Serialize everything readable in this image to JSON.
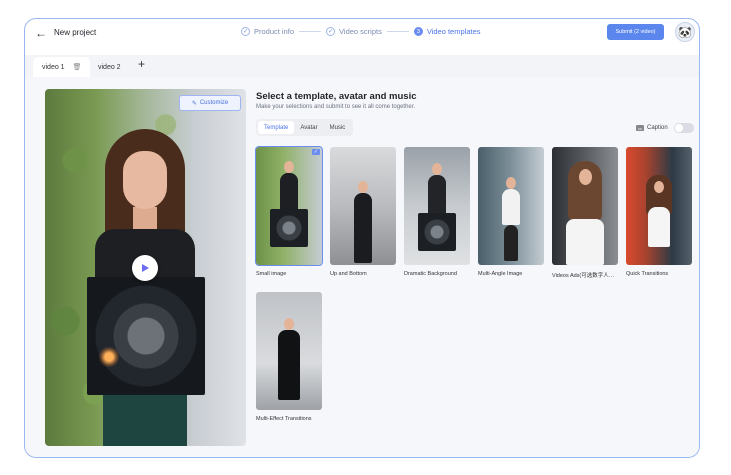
{
  "header": {
    "project_title": "New project",
    "steps": [
      {
        "label": "Product info",
        "state": "done"
      },
      {
        "label": "Video scripts",
        "state": "done"
      },
      {
        "label": "Video templates",
        "state": "active",
        "number": "3"
      }
    ],
    "submit_label": "Submit (2 video)"
  },
  "tabs": [
    {
      "label": "video 1",
      "active": true
    },
    {
      "label": "video 2",
      "active": false
    }
  ],
  "preview": {
    "customize_label": "Customize"
  },
  "panel": {
    "title": "Select a template, avatar and music",
    "subtitle": "Make your selections and submit to see it all come together.",
    "segments": [
      "Template",
      "Avatar",
      "Music"
    ],
    "active_segment": "Template",
    "caption_label": "Caption",
    "caption_on": false
  },
  "templates": [
    {
      "label": "Small image",
      "selected": true
    },
    {
      "label": "Up and Bottom",
      "selected": false
    },
    {
      "label": "Dramatic Background",
      "selected": false
    },
    {
      "label": "Multi-Angle Image",
      "selected": false
    },
    {
      "label": "Videos Ads(可选数字人…",
      "selected": false
    },
    {
      "label": "Quick Transitions",
      "selected": false
    },
    {
      "label": "Multi-Effect Transitions",
      "selected": false
    }
  ],
  "colors": {
    "accent": "#5b86ee",
    "frame_border": "#9ab7f0"
  },
  "icons": {
    "back": "arrow-left-icon",
    "trash": "trash-icon",
    "add": "plus-icon",
    "play": "play-icon",
    "edit": "edit-icon",
    "check": "check-icon"
  }
}
